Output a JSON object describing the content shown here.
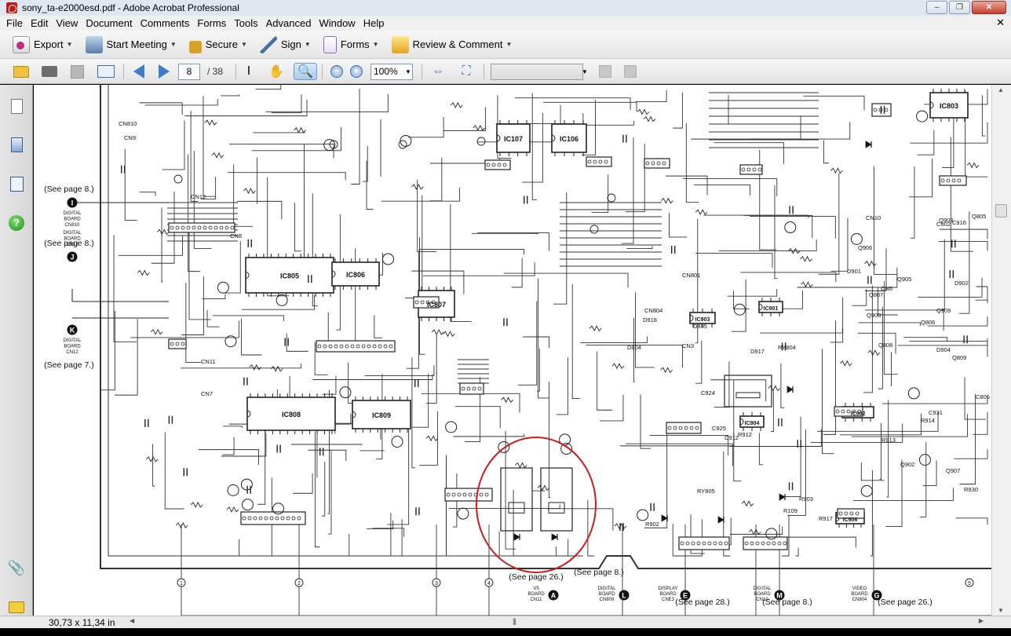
{
  "window": {
    "title": "sony_ta-e2000esd.pdf - Adobe Acrobat Professional",
    "minimize": "–",
    "maximize": "❐",
    "close": "✕"
  },
  "menu": {
    "items": [
      "File",
      "Edit",
      "View",
      "Document",
      "Comments",
      "Forms",
      "Tools",
      "Advanced",
      "Window",
      "Help"
    ],
    "close_doc": "✕"
  },
  "tasks_toolbar": {
    "export": "Export",
    "start_meeting": "Start Meeting",
    "secure": "Secure",
    "sign": "Sign",
    "forms": "Forms",
    "review_comment": "Review & Comment"
  },
  "nav_toolbar": {
    "current_page": "8",
    "total_pages": "/ 38",
    "zoom": "100%",
    "search_value": ""
  },
  "schematic": {
    "annotations_left": [
      {
        "ref": "(See page 8.)",
        "letter": "I",
        "board": [
          "DIGITAL",
          "BOARD",
          "CN810"
        ]
      },
      {
        "ref": "(See page 8.)",
        "letter": "J",
        "board": [
          "DIGITAL",
          "BOARD",
          "CN12"
        ]
      },
      {
        "ref": "(See page 7.)",
        "letter": "K",
        "board": [
          "DIGITAL",
          "BOARD",
          "CN12"
        ]
      }
    ],
    "annotations_bottom": [
      {
        "ref": "(See page 26.)",
        "letter": "A",
        "board": [
          "V5",
          "BOARD",
          "CN11"
        ]
      },
      {
        "ref": "(See page 8.)",
        "letter": "L",
        "board": [
          "DIGITAL",
          "BOARD",
          "CN809"
        ]
      },
      {
        "ref": "(See page 28.)",
        "letter": "E",
        "board": [
          "DISPLAY",
          "BOARD",
          "CNE3"
        ]
      },
      {
        "ref": "(See page 8.)",
        "letter": "M",
        "board": [
          "DIGITAL",
          "BOARD",
          "CN10"
        ]
      },
      {
        "ref": "(See page 26.)",
        "letter": "G",
        "board": [
          "VIDEO",
          "BOARD",
          "CN804"
        ]
      }
    ],
    "ic_labels": [
      "IC805",
      "IC806",
      "IC807",
      "IC808",
      "IC809",
      "IC107",
      "IC106",
      "IC901",
      "IC903",
      "IC902",
      "IC904",
      "IC906",
      "IC803"
    ],
    "part_labels": [
      "CN810",
      "CN9",
      "CN12",
      "CN8",
      "CN11",
      "CN7",
      "CN801",
      "CN804",
      "CN3",
      "CN10",
      "CN6",
      "Q807",
      "Q808",
      "Q809",
      "Q902",
      "Q907",
      "Q906",
      "Q908",
      "Q909",
      "Q905",
      "Q903",
      "Q805",
      "Q806",
      "D901",
      "D902",
      "D904",
      "D917",
      "D918",
      "D804",
      "D805",
      "RY804",
      "RY805",
      "R109",
      "R902",
      "R903",
      "R917",
      "R914",
      "R912",
      "R913",
      "R930",
      "C931",
      "C902",
      "C912",
      "C806",
      "C916",
      "C924",
      "C925"
    ],
    "axis_marks": [
      "1",
      "2",
      "3",
      "4",
      "5"
    ]
  },
  "status": {
    "page_size": "30,73 x 11,34 in"
  }
}
